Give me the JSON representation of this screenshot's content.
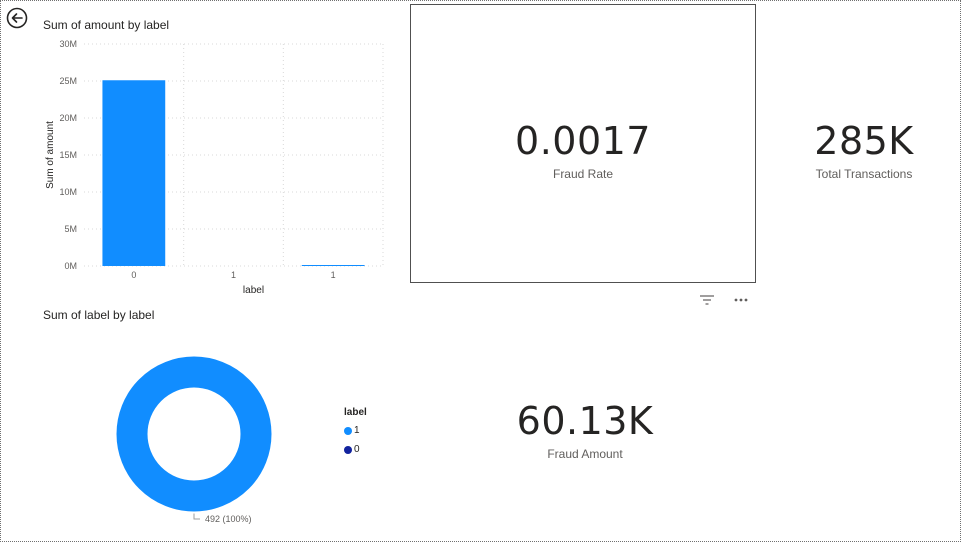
{
  "colors": {
    "bar": "#118DFF",
    "grid": "#d9d9d9",
    "axis_text": "#605e5c",
    "donut_1": "#118DFF",
    "donut_0": "#12239E"
  },
  "icons": {
    "back": "back-arrow-icon",
    "filter": "filter-icon",
    "more": "more-options-icon"
  },
  "cards": {
    "fraud_rate": {
      "value": "0.0017",
      "label": "Fraud Rate"
    },
    "total_transactions": {
      "value": "285K",
      "label": "Total Transactions"
    },
    "fraud_amount": {
      "value": "60.13K",
      "label": "Fraud Amount"
    }
  },
  "chart_data": [
    {
      "type": "bar",
      "title": "Sum of amount by label",
      "xlabel": "label",
      "ylabel": "Sum of amount",
      "categories": [
        "0",
        "1",
        "1"
      ],
      "values": [
        25100000,
        0,
        60130
      ],
      "ylim": [
        0,
        30000000
      ],
      "yticks": [
        0,
        5000000,
        10000000,
        15000000,
        20000000,
        25000000,
        30000000
      ],
      "ytick_labels": [
        "0M",
        "5M",
        "10M",
        "15M",
        "20M",
        "25M",
        "30M"
      ],
      "grid": true
    },
    {
      "type": "pie",
      "variant": "donut",
      "title": "Sum of label by label",
      "legend_title": "label",
      "legend_position": "right",
      "slices": [
        {
          "label": "1",
          "value": 492,
          "percent": 100,
          "data_label": "492 (100%)"
        },
        {
          "label": "0",
          "value": 0,
          "percent": 0
        }
      ]
    }
  ]
}
